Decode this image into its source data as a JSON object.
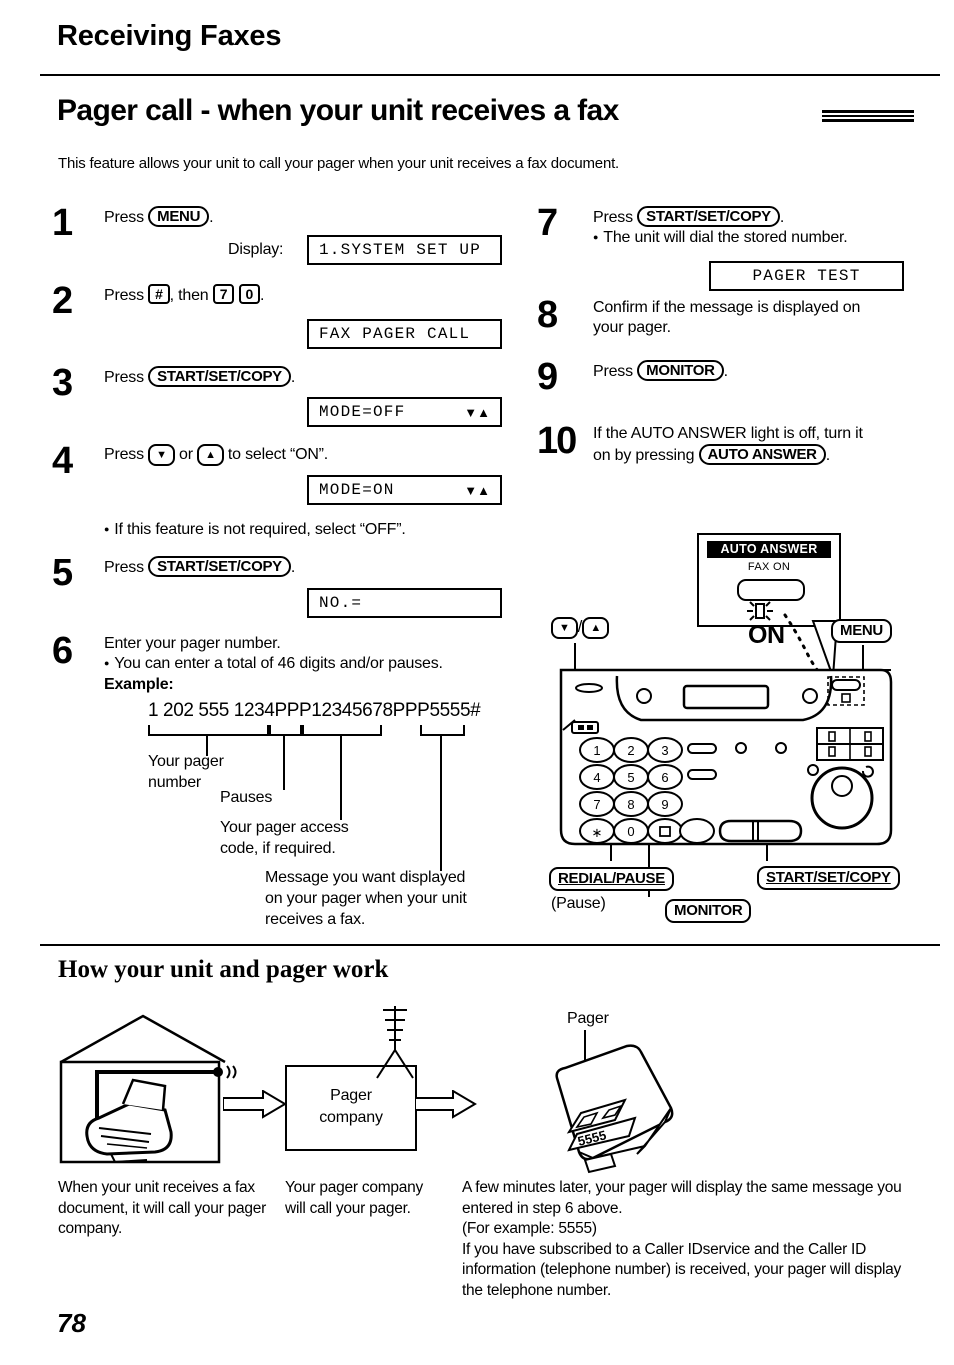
{
  "running_head": "Receiving Faxes",
  "section_title": "Pager call - when your unit receives a fax",
  "intro": "This feature allows your unit to call your pager when your unit receives a fax document.",
  "display_label": "Display:",
  "steps_left": [
    {
      "num": "1",
      "text_before": "Press",
      "key": "MENU",
      "text_after": ".",
      "lcd": "1.SYSTEM SET UP"
    },
    {
      "num": "2",
      "text_before": "Press",
      "key_hash": "#",
      "text_mid": ", then",
      "key_7": "7",
      "key_0": "0",
      "text_after": ".",
      "lcd": "FAX PAGER CALL"
    },
    {
      "num": "3",
      "text_before": "Press",
      "key": "START/SET/COPY",
      "text_after": ".",
      "lcd": "MODE=OFF",
      "lcd_arrows": "▼▲"
    },
    {
      "num": "4",
      "text_before": "Press",
      "key_down": "▼",
      "text_mid": "or",
      "key_up": "▲",
      "text_after": "to select “ON”.",
      "lcd": "MODE=ON",
      "lcd_arrows": "▼▲",
      "note": "If this feature is not required, select “OFF”."
    },
    {
      "num": "5",
      "text_before": "Press",
      "key": "START/SET/COPY",
      "text_after": ".",
      "lcd": "NO.="
    },
    {
      "num": "6",
      "line1": "Enter your pager number.",
      "bullet1": "You can enter a total of 46 digits and/or pauses.",
      "example_label": "Example:"
    }
  ],
  "example": {
    "number": "1 202 555 1234PPP12345678PPP5555#",
    "labels": {
      "pager_number": "Your pager\nnumber",
      "pauses": "Pauses",
      "access_code": "Your pager access\ncode, if required.",
      "message": "Message you want displayed\non your pager when your unit\nreceives a fax."
    }
  },
  "steps_right": [
    {
      "num": "7",
      "text_before": "Press",
      "key": "START/SET/COPY",
      "text_after": ".",
      "bullet1": "The unit will dial the stored number.",
      "lcd": "PAGER TEST"
    },
    {
      "num": "8",
      "line1": "Confirm if the message is displayed on",
      "line2": "your pager."
    },
    {
      "num": "9",
      "text_before": "Press",
      "key": "MONITOR",
      "text_after": "."
    },
    {
      "num": "10",
      "line1": "If the AUTO ANSWER light is off, turn it",
      "line2_before": "on by pressing",
      "key": "AUTO ANSWER",
      "line2_after": "."
    }
  ],
  "machine": {
    "auto_answer_tag": "AUTO ANSWER",
    "auto_answer_sub": "FAX ON",
    "on_text": "ON",
    "callout_updown_down": "▼",
    "callout_updown_sep": "/",
    "callout_updown_up": "▲",
    "callout_menu": "MENU",
    "callout_redial": "REDIAL/PAUSE",
    "callout_pause": "(Pause)",
    "callout_monitor": "MONITOR",
    "callout_startset": "START/SET/COPY",
    "keypad": [
      "1",
      "2",
      "3",
      "4",
      "5",
      "6",
      "7",
      "8",
      "9",
      "∗",
      "0",
      "□"
    ]
  },
  "how_section": {
    "title": "How your unit and pager work",
    "pager_company": "Pager\ncompany",
    "pager_label": "Pager",
    "pager_display": "5555",
    "caption1": "When your unit receives a fax document, it will call your pager company.",
    "caption2": "Your pager company will call your pager.",
    "caption3": "A few minutes later, your pager will display the same message you entered in step 6 above.\n(For example: 5555)\nIf you have subscribed to a Caller IDservice and the Caller ID information (telephone number) is received, your pager will display the telephone number."
  },
  "page_number": "78"
}
